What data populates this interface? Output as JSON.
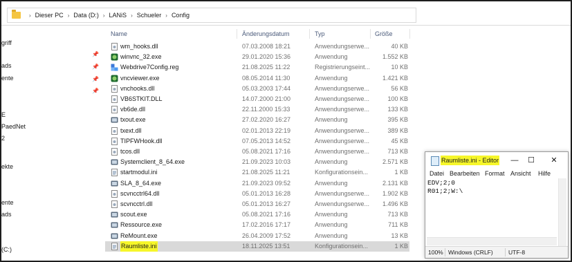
{
  "address_bar": {
    "crumbs": [
      "Dieser PC",
      "Data (D:)",
      "LANiS",
      "Schueler",
      "Config"
    ]
  },
  "sidebar": {
    "items": [
      "griff",
      "",
      "ads",
      "ente",
      "",
      "",
      "",
      "E",
      "PaedNet",
      "2",
      "",
      "ekte",
      "",
      "",
      "ente",
      "ads",
      "",
      "",
      "(C:)"
    ]
  },
  "columns": {
    "name": "Name",
    "date": "Änderungsdatum",
    "type": "Typ",
    "size": "Größe"
  },
  "files": [
    {
      "name": "wm_hooks.dll",
      "date": "07.03.2008 18:21",
      "type": "Anwendungserwe...",
      "size": "40 KB",
      "icon": "dll-icon"
    },
    {
      "name": "winvnc_32.exe",
      "date": "29.01.2020 15:36",
      "type": "Anwendung",
      "size": "1.552 KB",
      "icon": "vnc-icon"
    },
    {
      "name": "Webdrive7Config.reg",
      "date": "21.08.2025 11:22",
      "type": "Registrierungseint...",
      "size": "10 KB",
      "icon": "registry-icon"
    },
    {
      "name": "vncviewer.exe",
      "date": "08.05.2014 11:30",
      "type": "Anwendung",
      "size": "1.421 KB",
      "icon": "vnc-icon"
    },
    {
      "name": "vnchooks.dll",
      "date": "05.03.2003 17:44",
      "type": "Anwendungserwe...",
      "size": "56 KB",
      "icon": "dll-icon"
    },
    {
      "name": "VB6STKIT.DLL",
      "date": "14.07.2000 21:00",
      "type": "Anwendungserwe...",
      "size": "100 KB",
      "icon": "dll-icon"
    },
    {
      "name": "vb6de.dll",
      "date": "22.11.2000 15:33",
      "type": "Anwendungserwe...",
      "size": "133 KB",
      "icon": "dll-icon"
    },
    {
      "name": "txout.exe",
      "date": "27.02.2020 16:27",
      "type": "Anwendung",
      "size": "395 KB",
      "icon": "app-icon"
    },
    {
      "name": "txext.dll",
      "date": "02.01.2013 22:19",
      "type": "Anwendungserwe...",
      "size": "389 KB",
      "icon": "dll-icon"
    },
    {
      "name": "TIPFWHook.dll",
      "date": "07.05.2013 14:52",
      "type": "Anwendungserwe...",
      "size": "45 KB",
      "icon": "dll-icon"
    },
    {
      "name": "tcos.dll",
      "date": "05.08.2021 17:16",
      "type": "Anwendungserwe...",
      "size": "713 KB",
      "icon": "dll-icon"
    },
    {
      "name": "Systemclient_8_64.exe",
      "date": "21.09.2023 10:03",
      "type": "Anwendung",
      "size": "2.571 KB",
      "icon": "app-icon"
    },
    {
      "name": "startmodul.ini",
      "date": "21.08.2025 11:21",
      "type": "Konfigurationsein...",
      "size": "1 KB",
      "icon": "ini-icon"
    },
    {
      "name": "SLA_8_64.exe",
      "date": "21.09.2023 09:52",
      "type": "Anwendung",
      "size": "2.131 KB",
      "icon": "app-icon"
    },
    {
      "name": "scvncctrl64.dll",
      "date": "05.01.2013 16:28",
      "type": "Anwendungserwe...",
      "size": "1.902 KB",
      "icon": "dll-icon"
    },
    {
      "name": "scvncctrl.dll",
      "date": "05.01.2013 16:27",
      "type": "Anwendungserwe...",
      "size": "1.496 KB",
      "icon": "dll-icon"
    },
    {
      "name": "scout.exe",
      "date": "05.08.2021 17:16",
      "type": "Anwendung",
      "size": "713 KB",
      "icon": "app-icon"
    },
    {
      "name": "Ressource.exe",
      "date": "17.02.2016 17:17",
      "type": "Anwendung",
      "size": "711 KB",
      "icon": "app-icon"
    },
    {
      "name": "ReMount.exe",
      "date": "26.04.2009 17:52",
      "type": "Anwendung",
      "size": "13 KB",
      "icon": "app-icon"
    },
    {
      "name": "Raumliste.ini",
      "date": "18.11.2025 13:51",
      "type": "Konfigurationsein...",
      "size": "1 KB",
      "icon": "ini-icon",
      "selected": true
    }
  ],
  "notepad": {
    "title": "Raumliste.ini - Editor",
    "menu": [
      "Datei",
      "Bearbeiten",
      "Format",
      "Ansicht",
      "Hilfe"
    ],
    "lines": [
      "EDV;2;0",
      "R01;2;W:\\"
    ],
    "status": {
      "zoom": "100%",
      "eol": "Windows (CRLF)",
      "encoding": "UTF-8"
    },
    "minimize": "—",
    "maximize": "☐",
    "close": "✕"
  },
  "colors": {
    "highlight": "#f6f62a",
    "selection": "#d9d9d9",
    "header_text": "#4a5a7a"
  }
}
